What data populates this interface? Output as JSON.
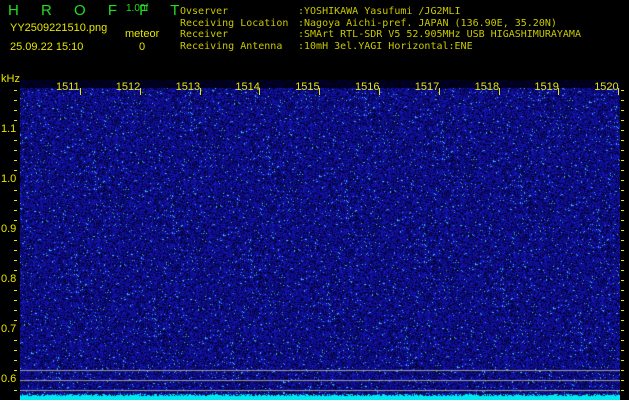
{
  "header": {
    "title": "H R O F F T",
    "version": "1.00f",
    "filename": "YY2509221510.png",
    "datetime": "25.09.22 15:10",
    "meteor_label": "meteor",
    "meteor_count": "0"
  },
  "info": [
    {
      "key": "Ovserver",
      "value": ":YOSHIKAWA Yasufumi /JG2MLI"
    },
    {
      "key": "Receiving Location",
      "value": ":Nagoya Aichi-pref. JAPAN (136.90E, 35.20N)"
    },
    {
      "key": "Receiver",
      "value": ":SMArt RTL-SDR V5 52.905MHz USB HIGASHIMURAYAMA"
    },
    {
      "key": "Receiving Antenna",
      "value": ":10mH 3el.YAGI Horizontal:ENE"
    }
  ],
  "axis": {
    "y_unit": "kHz",
    "y_labels": [
      "1.1",
      "1.0",
      "0.9",
      "0.8",
      "0.7",
      "0.6"
    ],
    "time_labels": [
      "1511",
      "1512",
      "1513",
      "1514",
      "1515",
      "1516",
      "1517",
      "1518",
      "1519",
      "1520"
    ]
  },
  "colors": {
    "background": "#000000",
    "spectrum": "#1a1ad0",
    "noise_floor": "#00e8f0",
    "text": "#e6e600",
    "title": "#22dd22"
  }
}
